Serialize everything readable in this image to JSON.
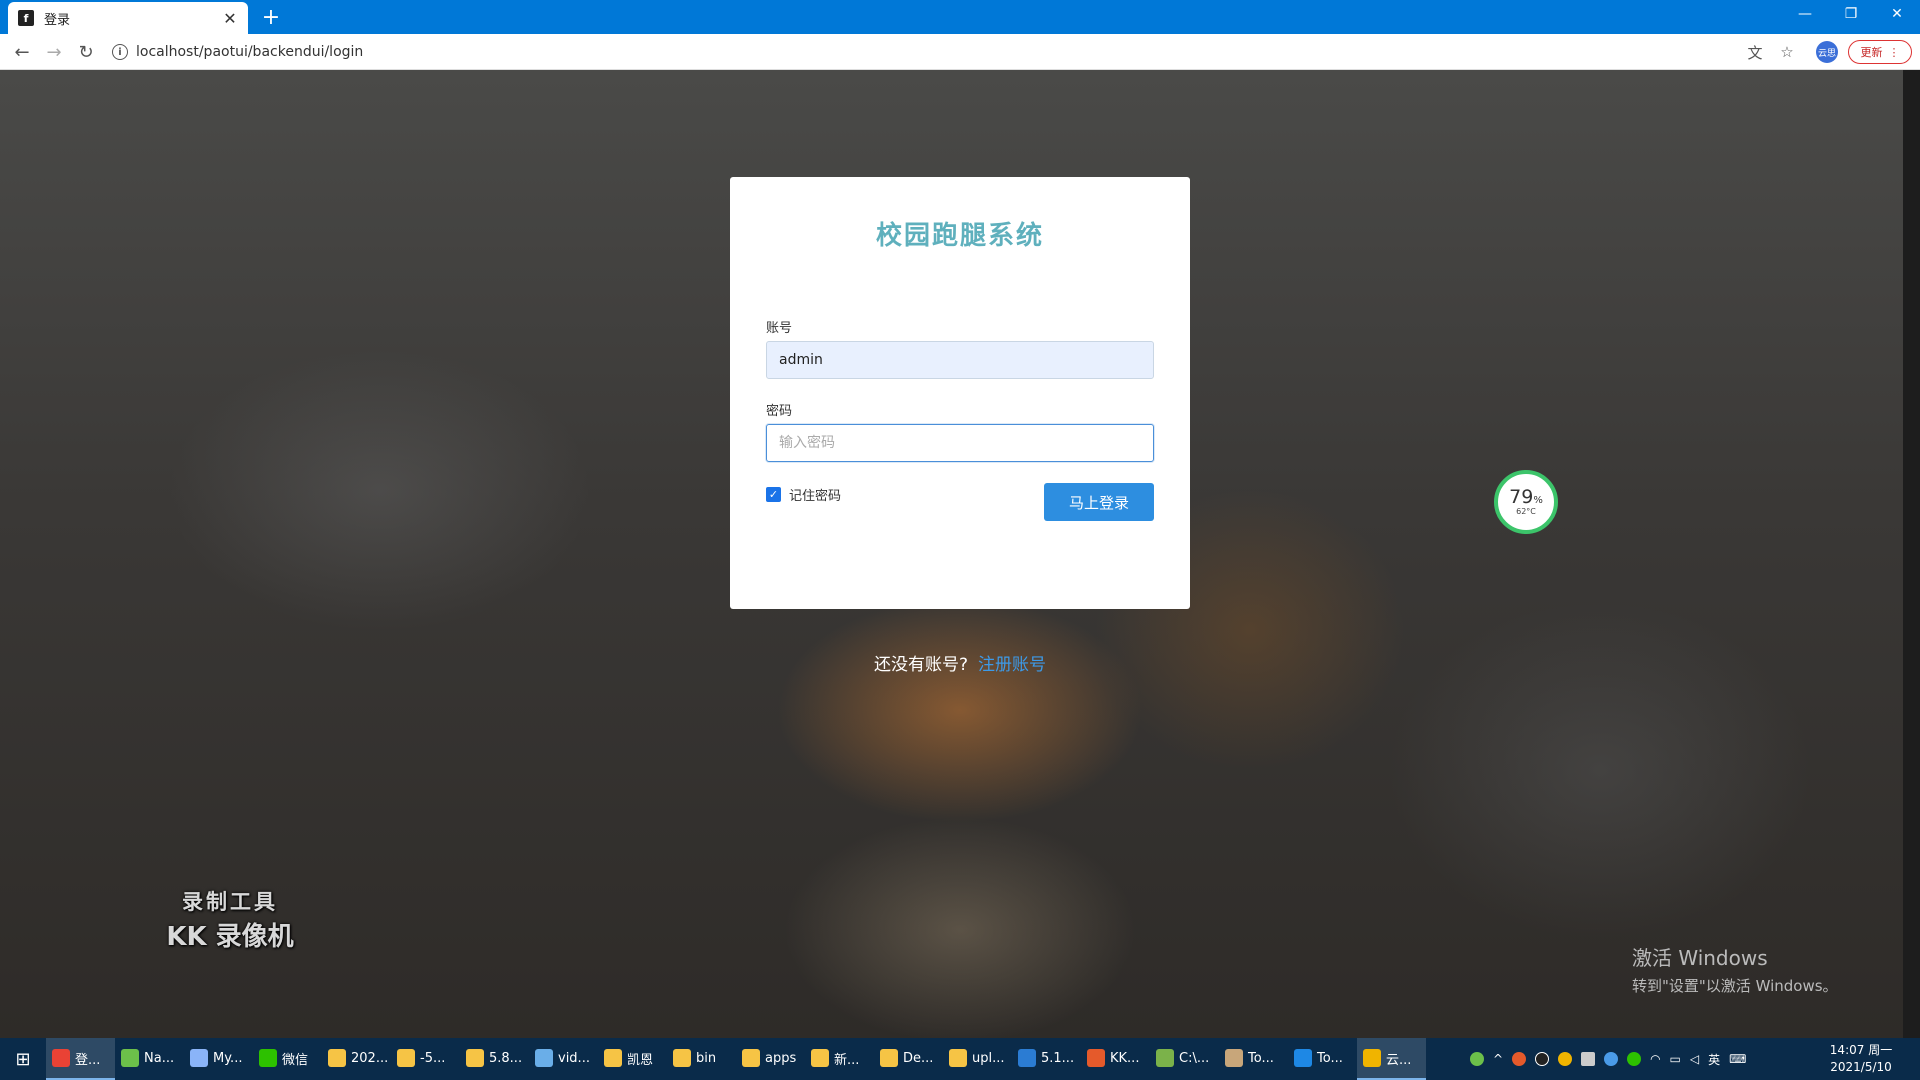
{
  "browser": {
    "tab_title": "登录",
    "favicon_text": "f",
    "url": "localhost/paotui/backendui/login",
    "update_label": "更新",
    "profile_label": "云思",
    "accent": "#0078d7"
  },
  "login": {
    "title": "校园跑腿系统",
    "account_label": "账号",
    "account_value": "admin",
    "password_label": "密码",
    "password_placeholder": "输入密码",
    "remember_label": "记住密码",
    "remember_checked": true,
    "submit_label": "马上登录"
  },
  "register": {
    "question": "还没有账号?",
    "link": "注册账号"
  },
  "overlays": {
    "gauge_percent": "79",
    "gauge_unit": "%",
    "gauge_temp": "62°C",
    "watermark_line1": "录制工具",
    "watermark_line2": "KK 录像机",
    "activate_line1": "激活 Windows",
    "activate_line2": "转到\"设置\"以激活 Windows。"
  },
  "taskbar": {
    "items": [
      {
        "label": "登...",
        "color": "#e94235",
        "active": true
      },
      {
        "label": "Na...",
        "color": "#6cc04a",
        "active": false
      },
      {
        "label": "My...",
        "color": "#8ab4f8",
        "active": false
      },
      {
        "label": "微信",
        "color": "#2dc100",
        "active": false
      },
      {
        "label": "202...",
        "color": "#f6c445",
        "active": false
      },
      {
        "label": "-5...",
        "color": "#f6c445",
        "active": false
      },
      {
        "label": "5.8...",
        "color": "#f6c445",
        "active": false
      },
      {
        "label": "vid...",
        "color": "#6aaee8",
        "active": false
      },
      {
        "label": "凯恩",
        "color": "#f6c445",
        "active": false
      },
      {
        "label": "bin",
        "color": "#f6c445",
        "active": false
      },
      {
        "label": "apps",
        "color": "#f6c445",
        "active": false
      },
      {
        "label": "新...",
        "color": "#f6c445",
        "active": false
      },
      {
        "label": "De...",
        "color": "#f6c445",
        "active": false
      },
      {
        "label": "upl...",
        "color": "#f6c445",
        "active": false
      },
      {
        "label": "5.1...",
        "color": "#2b7cd3",
        "active": false
      },
      {
        "label": "KK...",
        "color": "#e55a2b",
        "active": false
      },
      {
        "label": "C:\\...",
        "color": "#7bb24a",
        "active": false
      },
      {
        "label": "To...",
        "color": "#c8a67a",
        "active": false
      },
      {
        "label": "To...",
        "color": "#1e88e5",
        "active": false
      },
      {
        "label": "云...",
        "color": "#f0b400",
        "active": true
      }
    ],
    "ime": "英",
    "time": "14:07 周一",
    "date": "2021/5/10"
  }
}
